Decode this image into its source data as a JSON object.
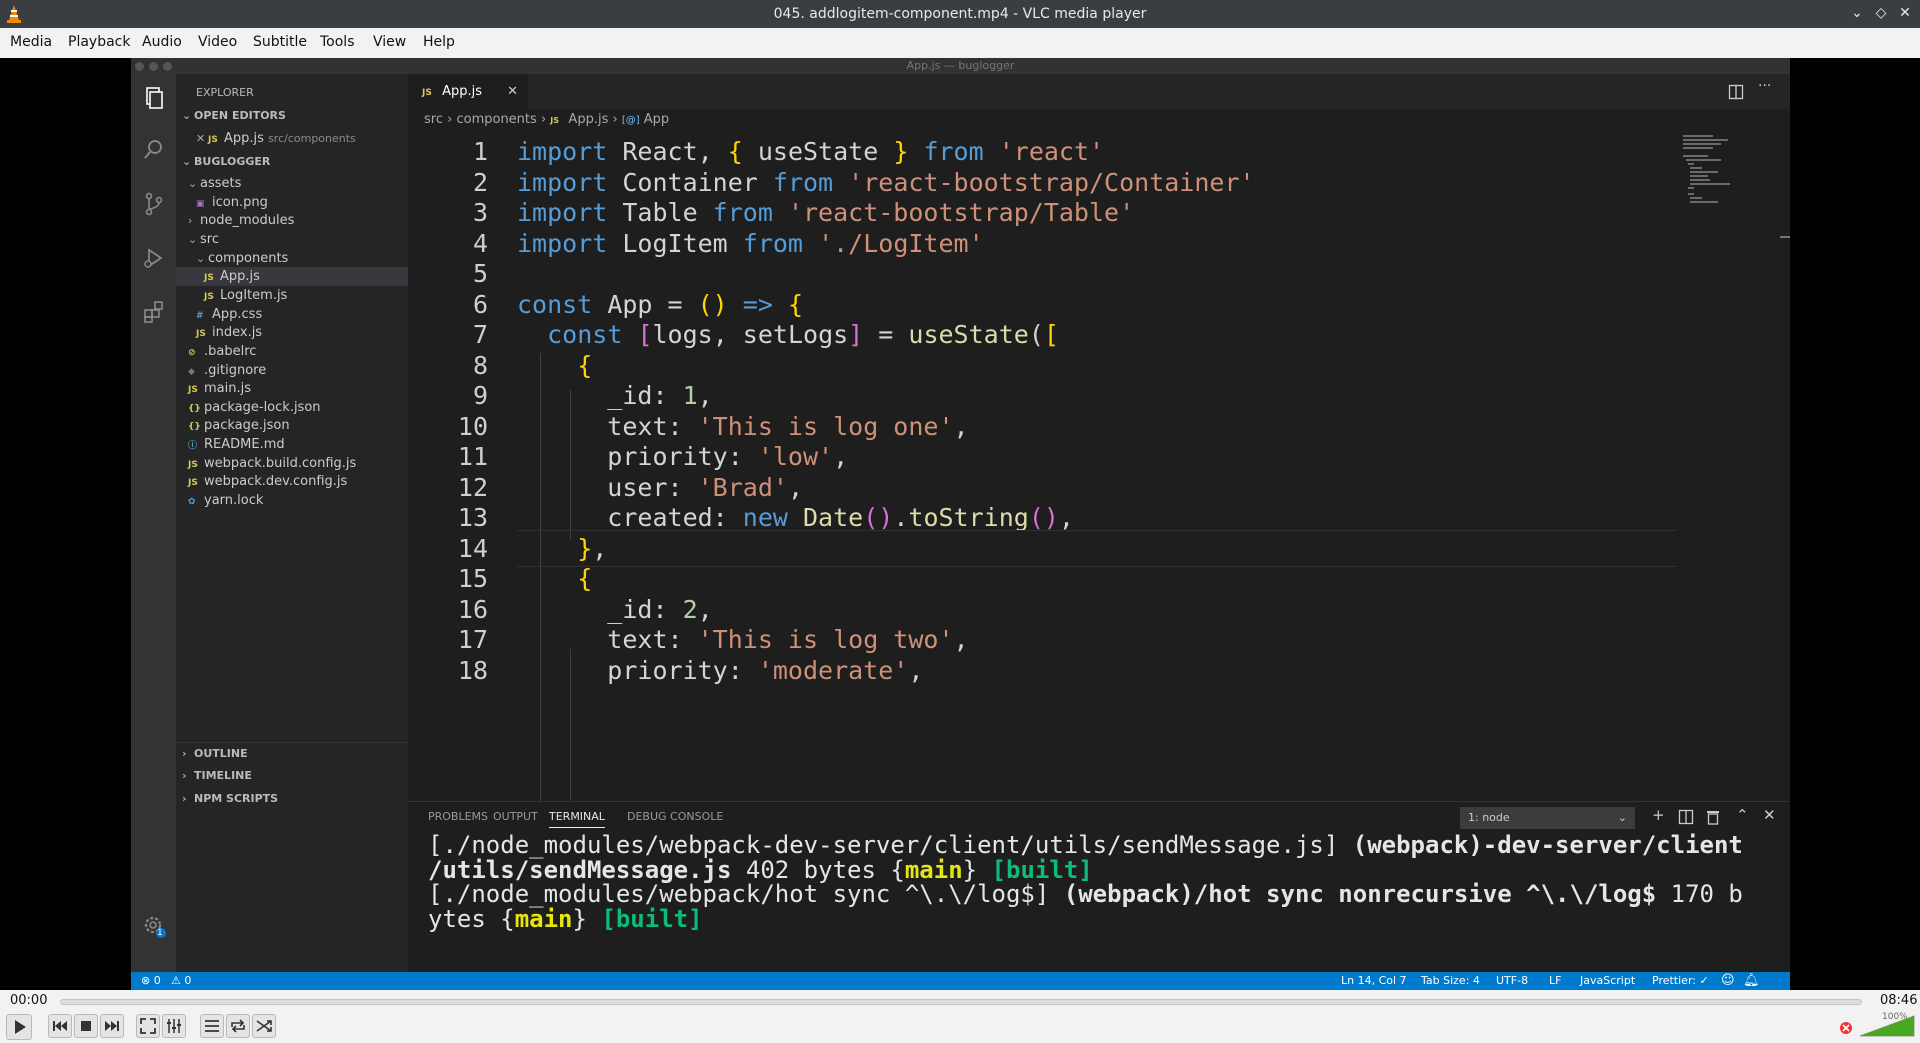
{
  "window": {
    "title": "045. addlogitem-component.mp4 - VLC media player",
    "min_glyph": "⌄",
    "restore_glyph": "◇",
    "close_glyph": "✕"
  },
  "menu": [
    "Media",
    "Playback",
    "Audio",
    "Video",
    "Subtitle",
    "Tools",
    "View",
    "Help"
  ],
  "vscode": {
    "window_title": "App.js — buglogger",
    "sidebar": {
      "title": "EXPLORER",
      "open_editors_label": "OPEN EDITORS",
      "open_editor_file": "App.js",
      "open_editor_path": "src/components",
      "project_label": "BUGLOGGER",
      "tree": [
        {
          "name": "assets",
          "type": "folder-open",
          "depth": 0
        },
        {
          "name": "icon.png",
          "type": "img",
          "depth": 1
        },
        {
          "name": "node_modules",
          "type": "folder",
          "depth": 0
        },
        {
          "name": "src",
          "type": "folder-open",
          "depth": 0
        },
        {
          "name": "components",
          "type": "folder-open",
          "depth": 1
        },
        {
          "name": "App.js",
          "type": "js",
          "depth": 2,
          "selected": true
        },
        {
          "name": "LogItem.js",
          "type": "js",
          "depth": 2
        },
        {
          "name": "App.css",
          "type": "css",
          "depth": 1
        },
        {
          "name": "index.js",
          "type": "js",
          "depth": 1
        },
        {
          "name": ".babelrc",
          "type": "babel",
          "depth": 0
        },
        {
          "name": ".gitignore",
          "type": "git",
          "depth": 0
        },
        {
          "name": "main.js",
          "type": "js",
          "depth": 0
        },
        {
          "name": "package-lock.json",
          "type": "json",
          "depth": 0
        },
        {
          "name": "package.json",
          "type": "json",
          "depth": 0
        },
        {
          "name": "README.md",
          "type": "info",
          "depth": 0
        },
        {
          "name": "webpack.build.config.js",
          "type": "js",
          "depth": 0
        },
        {
          "name": "webpack.dev.config.js",
          "type": "js",
          "depth": 0
        },
        {
          "name": "yarn.lock",
          "type": "yarn",
          "depth": 0
        }
      ],
      "bottom_sections": [
        "OUTLINE",
        "TIMELINE",
        "NPM SCRIPTS"
      ]
    },
    "tab": {
      "label": "App.js",
      "file_tag": "JS"
    },
    "breadcrumb": [
      "src",
      "components",
      "App.js",
      "App"
    ],
    "breadcrumb_js_tag": "JS",
    "breadcrumb_symbol_tag": "[@]",
    "code_lines": [
      [
        [
          "kw",
          "import"
        ],
        [
          "t",
          " React, "
        ],
        [
          "br",
          "{"
        ],
        [
          "t",
          " useState "
        ],
        [
          "br",
          "}"
        ],
        [
          "t",
          " "
        ],
        [
          "kw",
          "from"
        ],
        [
          "t",
          " "
        ],
        [
          "str",
          "'react'"
        ]
      ],
      [
        [
          "kw",
          "import"
        ],
        [
          "t",
          " Container "
        ],
        [
          "kw",
          "from"
        ],
        [
          "t",
          " "
        ],
        [
          "str",
          "'react-bootstrap/Container'"
        ]
      ],
      [
        [
          "kw",
          "import"
        ],
        [
          "t",
          " Table "
        ],
        [
          "kw",
          "from"
        ],
        [
          "t",
          " "
        ],
        [
          "str",
          "'react-bootstrap/Table'"
        ]
      ],
      [
        [
          "kw",
          "import"
        ],
        [
          "t",
          " LogItem "
        ],
        [
          "kw",
          "from"
        ],
        [
          "t",
          " "
        ],
        [
          "str",
          "'./LogItem'"
        ]
      ],
      [],
      [
        [
          "kw",
          "const"
        ],
        [
          "t",
          " App = "
        ],
        [
          "br",
          "()"
        ],
        [
          "t",
          " "
        ],
        [
          "kw",
          "=>"
        ],
        [
          "t",
          " "
        ],
        [
          "br",
          "{"
        ]
      ],
      [
        [
          "t",
          "  "
        ],
        [
          "kw",
          "const"
        ],
        [
          "t",
          " "
        ],
        [
          "br2",
          "["
        ],
        [
          "t",
          "logs, setLogs"
        ],
        [
          "br2",
          "]"
        ],
        [
          "t",
          " = "
        ],
        [
          "fn",
          "useState"
        ],
        [
          "t",
          "("
        ],
        [
          "br",
          "["
        ]
      ],
      [
        [
          "t",
          "    "
        ],
        [
          "br",
          "{"
        ]
      ],
      [
        [
          "t",
          "      _id: "
        ],
        [
          "num",
          "1"
        ],
        [
          "t",
          ","
        ]
      ],
      [
        [
          "t",
          "      text: "
        ],
        [
          "str",
          "'This is log one'"
        ],
        [
          "t",
          ","
        ]
      ],
      [
        [
          "t",
          "      priority: "
        ],
        [
          "str",
          "'low'"
        ],
        [
          "t",
          ","
        ]
      ],
      [
        [
          "t",
          "      user: "
        ],
        [
          "str",
          "'Brad'"
        ],
        [
          "t",
          ","
        ]
      ],
      [
        [
          "t",
          "      created: "
        ],
        [
          "kw",
          "new"
        ],
        [
          "t",
          " "
        ],
        [
          "fn",
          "Date"
        ],
        [
          "br2",
          "()"
        ],
        [
          "t",
          "."
        ],
        [
          "fn",
          "toString"
        ],
        [
          "br2",
          "()"
        ],
        [
          "t",
          ","
        ]
      ],
      [
        [
          "t",
          "    "
        ],
        [
          "br",
          "}"
        ],
        [
          "t",
          ","
        ]
      ],
      [
        [
          "t",
          "    "
        ],
        [
          "br",
          "{"
        ]
      ],
      [
        [
          "t",
          "      _id: "
        ],
        [
          "num",
          "2"
        ],
        [
          "t",
          ","
        ]
      ],
      [
        [
          "t",
          "      text: "
        ],
        [
          "str",
          "'This is log two'"
        ],
        [
          "t",
          ","
        ]
      ],
      [
        [
          "t",
          "      priority: "
        ],
        [
          "str",
          "'moderate'"
        ],
        [
          "t",
          ","
        ]
      ]
    ],
    "panel": {
      "tabs": [
        "PROBLEMS",
        "OUTPUT",
        "TERMINAL",
        "DEBUG CONSOLE"
      ],
      "active_tab": "TERMINAL",
      "terminal_select": "1: node",
      "terminal_lines": [
        [
          [
            "t",
            "[./node_modules/webpack-dev-server/client/utils/sendMessage.js] "
          ],
          [
            "tb",
            "(webpack)-dev-server/client"
          ]
        ],
        [
          [
            "tb",
            "/utils/sendMessage.js"
          ],
          [
            "t",
            " 402 bytes "
          ],
          [
            "t",
            "{"
          ],
          [
            "ty",
            "main"
          ],
          [
            "t",
            "}"
          ],
          [
            "t",
            " "
          ],
          [
            "tg",
            "[built]"
          ]
        ],
        [
          [
            "t",
            "[./node_modules/webpack/hot sync ^\\.\\/log$] "
          ],
          [
            "tb",
            "(webpack)/hot sync nonrecursive ^\\.\\/log$"
          ],
          [
            "t",
            " 170 b"
          ]
        ],
        [
          [
            "t",
            "ytes "
          ],
          [
            "t",
            "{"
          ],
          [
            "ty",
            "main"
          ],
          [
            "t",
            "}"
          ],
          [
            "t",
            " "
          ],
          [
            "tg",
            "[built]"
          ]
        ]
      ]
    },
    "status": {
      "errors": "⊗ 0",
      "warnings": "⚠ 0",
      "position": "Ln 14, Col 7",
      "tab_size": "Tab Size: 4",
      "encoding": "UTF-8",
      "eol": "LF",
      "language": "JavaScript",
      "prettier": "Prettier: ✓"
    },
    "settings_badge": "1"
  },
  "player": {
    "time_elapsed": "00:00",
    "time_total": "08:46",
    "progress": 0.0,
    "volume_label": "100%",
    "volume": 1.0
  }
}
